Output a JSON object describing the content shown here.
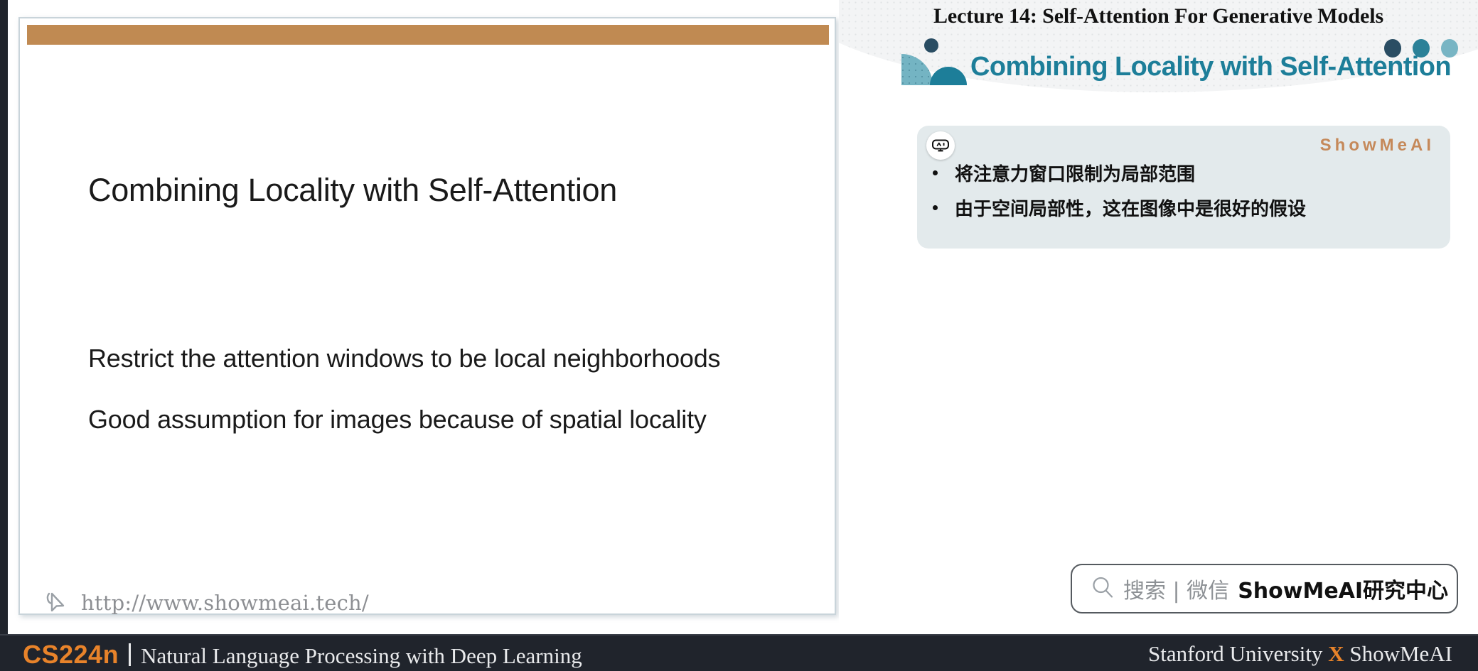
{
  "lecture": {
    "header_title": "Lecture 14:  Self-Attention For Generative Models"
  },
  "slide": {
    "title": "Combining Locality with Self-Attention",
    "body_lines": [
      "Restrict the attention windows to be local neighborhoods",
      "Good assumption for images because of spatial locality"
    ],
    "watermark_url": "http://www.showmeai.tech/",
    "watermark_icon": "cursor-pointer-icon",
    "top_bar_color": "#c08a52"
  },
  "right_panel": {
    "section_title": "Combining Locality with Self-Attention",
    "section_title_color": "#1d7e99",
    "brandmark_icon": "showmeai-logo-icon",
    "header_dots": [
      {
        "name": "dot-dark-navy",
        "color": "#2a4d63"
      },
      {
        "name": "dot-teal",
        "color": "#2b8198"
      },
      {
        "name": "dot-light-teal",
        "color": "#78b5c4"
      }
    ],
    "card": {
      "background_color": "#e3eaec",
      "badge_icon": "ai-robot-face-icon",
      "badge_text": "AI",
      "brand": "ShowMeAI",
      "brand_color": "#c5895a",
      "bullets": [
        "将注意力窗口限制为局部范围",
        "由于空间局部性，这在图像中是很好的假设"
      ]
    }
  },
  "search": {
    "icon": "search-icon",
    "placeholder_gray": "搜索 | 微信",
    "value_bold": "ShowMeAI研究中心"
  },
  "footer": {
    "background_color": "#20242c",
    "course_code": "CS224n",
    "course_code_color": "#e8832a",
    "course_name": "Natural Language Processing with Deep Learning",
    "right_prefix": "Stanford University ",
    "right_x": "X",
    "right_suffix": " ShowMeAI"
  }
}
